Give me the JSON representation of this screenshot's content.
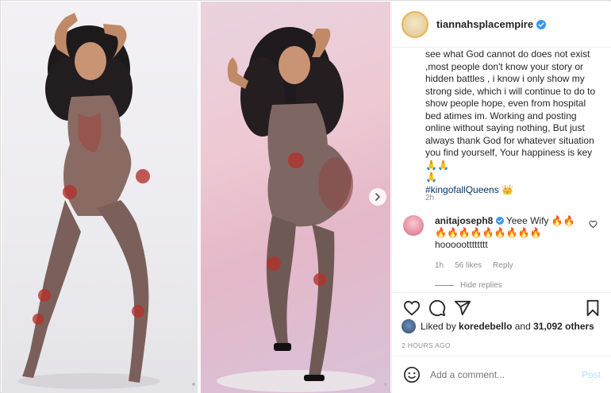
{
  "post": {
    "username": "tiannahsplacempire",
    "caption_text": "see what God cannot do does not exist ,most people don't know your story or hidden battles , i know i only show my strong side, which i will continue to do to show people hope, even from hospital bed atimes im. Working and posting online without saying nothing, But just always thank God for whatever situation you find yourself, Your happiness is key 🙏🙏\n🙏",
    "hashtag": "#kingofallQueens 👑",
    "caption_time": "2h"
  },
  "comment": {
    "username": "anitajoseph8",
    "text": "Yeee Wify 🔥🔥",
    "line2": "🔥🔥🔥🔥🔥🔥🔥🔥🔥",
    "line3": "hoooootttttttt",
    "time": "1h",
    "likes": "56 likes",
    "reply": "Reply",
    "hide_replies": "Hide replies"
  },
  "likes": {
    "prefix": "Liked by",
    "user": "koredebello",
    "suffix": "and",
    "others": "31,092 others"
  },
  "posted_time": "2 HOURS AGO",
  "add_comment": {
    "placeholder": "Add a comment...",
    "post_label": "Post"
  },
  "colors": {
    "verified": "#3897f0",
    "post_disabled": "#b2dffc",
    "hashtag": "#00376b"
  }
}
